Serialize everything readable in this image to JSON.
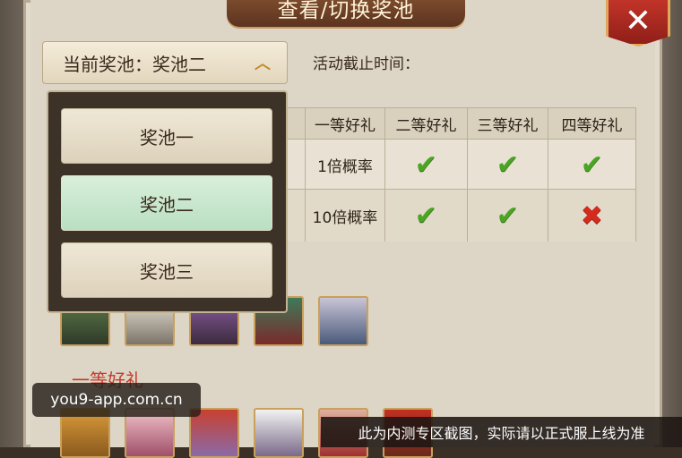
{
  "title": "查看/切换奖池",
  "close_glyph": "✕",
  "pool_select": {
    "label": "当前奖池：奖池二",
    "chevron_icon": "chevron-up-icon"
  },
  "deadline_label": "活动截止时间：",
  "dropdown": {
    "options": [
      "奖池一",
      "奖池二",
      "奖池三"
    ],
    "selected": "奖池二"
  },
  "table": {
    "headers": [
      "礼",
      "一等好礼",
      "二等好礼",
      "三等好礼",
      "四等好礼"
    ],
    "rows": [
      {
        "rate": "1倍概率",
        "marks": [
          "check",
          "check",
          "check"
        ]
      },
      {
        "rate": "10倍概率",
        "marks": [
          "check",
          "check",
          "cross"
        ]
      }
    ]
  },
  "prize_section_title": "一等好礼",
  "watermark": "you9-app.com.cn",
  "footer_notice": "此为内测专区截图，实际请以正式服上线为准",
  "colors": {
    "check": "#4aa522",
    "cross": "#d42b1d",
    "selected_option": "#c5e6cb",
    "title_banner": "#6b3d25"
  }
}
